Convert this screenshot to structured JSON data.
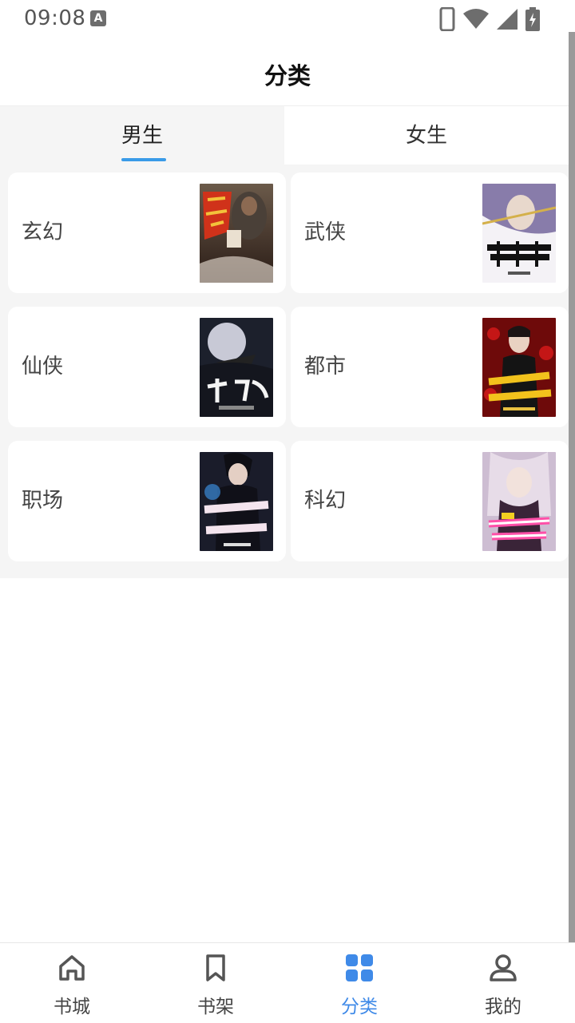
{
  "status_bar": {
    "time": "09:08",
    "notification_icon": "a-letter-icon",
    "icons": [
      "phone-icon",
      "wifi-icon",
      "signal-icon",
      "battery-charging-icon"
    ]
  },
  "app_bar": {
    "title": "分类"
  },
  "tabs": [
    {
      "label": "男生",
      "selected": true
    },
    {
      "label": "女生",
      "selected": false
    }
  ],
  "categories": [
    {
      "label": "玄幻",
      "cover_title": "战神狂飙",
      "cover_colors": [
        "#3b2a22",
        "#c43a1c"
      ]
    },
    {
      "label": "武侠",
      "cover_title": "偷香高手",
      "cover_colors": [
        "#f3f1f5",
        "#111111"
      ]
    },
    {
      "label": "仙侠",
      "cover_title": "打更人",
      "cover_colors": [
        "#1e2230",
        "#d9d9e6"
      ]
    },
    {
      "label": "都市",
      "cover_title": "都市之最强狂兵",
      "cover_colors": [
        "#7a0c0c",
        "#f0c020"
      ]
    },
    {
      "label": "职场",
      "cover_title": "巅峰权贵",
      "cover_colors": [
        "#181a2a",
        "#e8d0e0"
      ]
    },
    {
      "label": "科幻",
      "cover_title": "大反派之开局退婚女主",
      "cover_colors": [
        "#c9b8cf",
        "#ff5fae"
      ]
    }
  ],
  "bottom_nav": [
    {
      "label": "书城",
      "icon": "home-icon",
      "active": false
    },
    {
      "label": "书架",
      "icon": "bookmark-icon",
      "active": false
    },
    {
      "label": "分类",
      "icon": "grid-icon",
      "active": true
    },
    {
      "label": "我的",
      "icon": "person-icon",
      "active": false
    }
  ],
  "colors": {
    "accent": "#3f8ae8",
    "tab_underline": "#3a9be8",
    "background": "#f5f5f5"
  }
}
